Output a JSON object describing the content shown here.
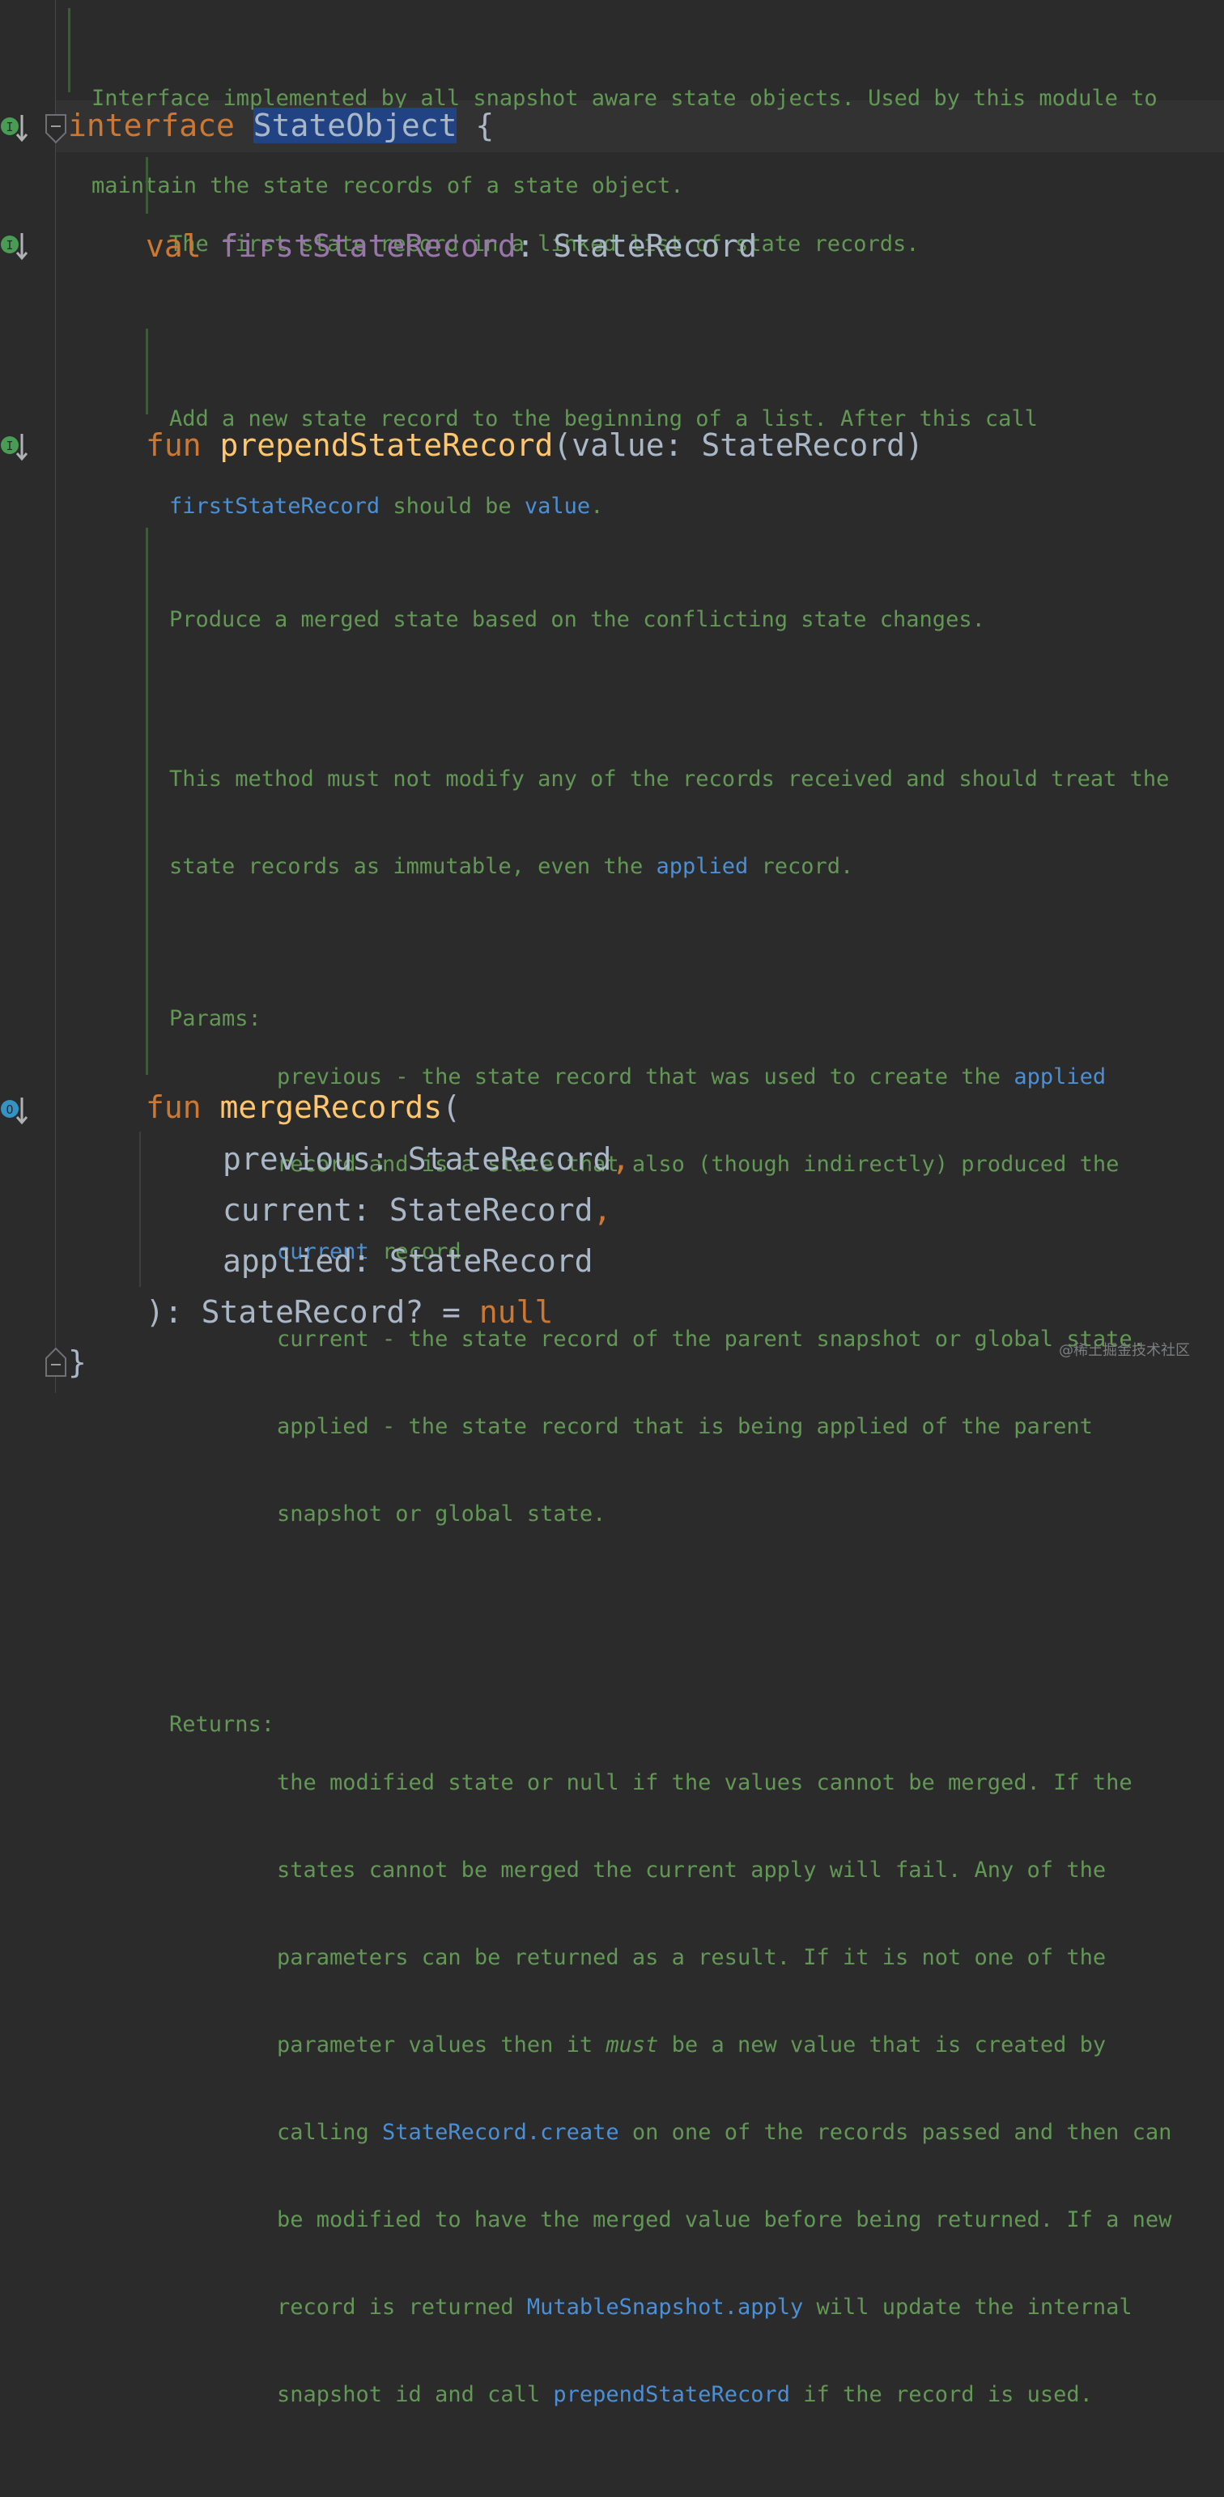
{
  "colors": {
    "background": "#2b2b2b",
    "keyword": "#cc7832",
    "property": "#9876aa",
    "function": "#ffc66d",
    "doc_text": "#629755",
    "doc_link": "#4b8fd6",
    "selection": "#214283",
    "gutter_icon_interface": "#499c54",
    "gutter_icon_override": "#3592c4"
  },
  "gutter_icons": [
    "implemented-interface-icon",
    "implemented-member-icon",
    "implemented-member-icon",
    "overridden-member-icon"
  ],
  "doc_interface": {
    "line1": "Interface implemented by all snapshot aware state objects. Used by this module to",
    "line2": "maintain the state records of a state object."
  },
  "interface_decl": {
    "keyword": "interface",
    "name": "StateObject",
    "brace": "{",
    "close": "}"
  },
  "doc_first_record": {
    "line1": "The first state record in a linked list of state records."
  },
  "prop_decl": {
    "keyword": "val",
    "name": "firstStateRecord",
    "colon": ":",
    "type": "StateRecord"
  },
  "doc_prepend": {
    "line1": "Add a new state record to the beginning of a list. After this call",
    "link1": "firstStateRecord",
    "mid": " should be ",
    "link2": "value",
    "end": "."
  },
  "prepend_decl": {
    "keyword": "fun",
    "name": "prependStateRecord",
    "params": "(value: StateRecord)"
  },
  "doc_merge": {
    "p1": "Produce a merged state based on the conflicting state changes.",
    "p2_line1": "This method must not modify any of the records received and should treat the",
    "p2_line2_pre": "state records as immutable, even the ",
    "p2_line2_link": "applied",
    "p2_line2_post": " record.",
    "params_label": "Params:",
    "params_l1_pre": "previous - the state record that was used to create the ",
    "params_l1_link": "applied",
    "params_l2": "record and is a state that also (though indirectly) produced the",
    "params_l3_link": "current",
    "params_l3_post": " record.",
    "params_l4": "current - the state record of the parent snapshot or global state.",
    "params_l5": "applied - the state record that is being applied of the parent",
    "params_l6": "snapshot or global state.",
    "returns_label": "Returns:",
    "ret_l1": "the modified state or null if the values cannot be merged. If the",
    "ret_l2": "states cannot be merged the current apply will fail. Any of the",
    "ret_l3": "parameters can be returned as a result. If it is not one of the",
    "ret_l4_pre": "parameter values then it ",
    "ret_l4_em": "must",
    "ret_l4_post": " be a new value that is created by",
    "ret_l5_pre": "calling ",
    "ret_l5_link": "StateRecord.create",
    "ret_l5_post": " on one of the records passed and then can",
    "ret_l6": "be modified to have the merged value before being returned. If a new",
    "ret_l7_pre": "record is returned ",
    "ret_l7_link": "MutableSnapshot.apply",
    "ret_l7_post": " will update the internal",
    "ret_l8_pre": "snapshot id and call ",
    "ret_l8_link": "prependStateRecord",
    "ret_l8_post": " if the record is used."
  },
  "merge_decl": {
    "keyword": "fun",
    "name": "mergeRecords",
    "open": "(",
    "p1_name": "previous: StateRecord",
    "comma": ",",
    "p2_name": "current: StateRecord",
    "p3_name": "applied: StateRecord",
    "ret_pre": "): StateRecord? = ",
    "ret_null": "null"
  },
  "watermark": "@稀土掘金技术社区"
}
